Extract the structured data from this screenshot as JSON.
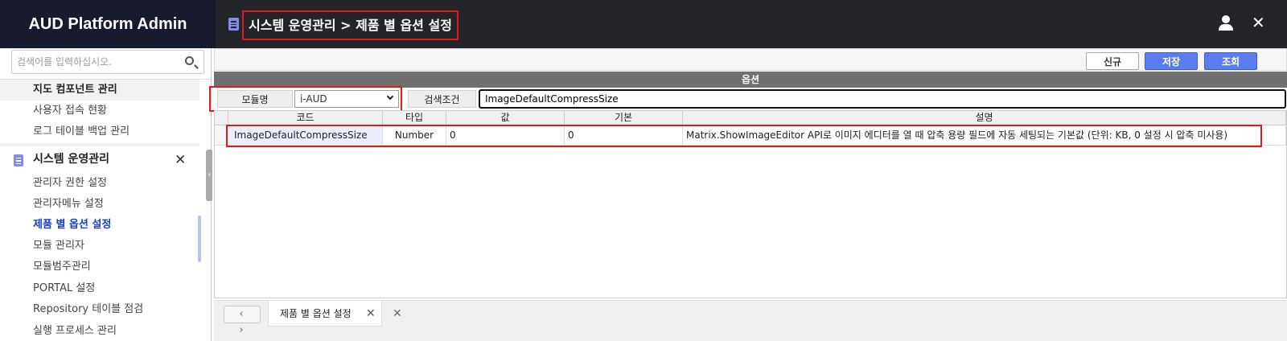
{
  "app": {
    "title": "AUD Platform Admin"
  },
  "header": {
    "page_title": "시스템 운영관리 > 제품 별 옵션 설정",
    "close_label": "✕"
  },
  "sidebar": {
    "search_placeholder": "검색어를 입력하십시오.",
    "items_before": [
      {
        "label": "지도 컴포넌트 관리"
      },
      {
        "label": "사용자 접속 현황"
      },
      {
        "label": "로그 테이블 백업 관리"
      }
    ],
    "group": {
      "label": "시스템 운영관리",
      "close_label": "✕"
    },
    "items": [
      {
        "label": "관리자 권한 설정"
      },
      {
        "label": "관리자메뉴 설정"
      },
      {
        "label": "제품 별 옵션 설정",
        "active": true
      },
      {
        "label": "모듈 관리자"
      },
      {
        "label": "모듈범주관리"
      },
      {
        "label": "PORTAL 설정"
      },
      {
        "label": "Repository 테이블 점검"
      },
      {
        "label": "실행 프로세스 관리"
      }
    ]
  },
  "toolbar": {
    "new_label": "신규",
    "save_label": "저장",
    "query_label": "조회"
  },
  "panel": {
    "title": "옵션"
  },
  "filters": {
    "module_label": "모듈명",
    "module_value": "i-AUD",
    "condition_label": "검색조건",
    "condition_value": "ImageDefaultCompressSize"
  },
  "grid": {
    "columns": [
      "코드",
      "타입",
      "값",
      "기본",
      "설명"
    ],
    "rows": [
      {
        "code": "ImageDefaultCompressSize",
        "type": "Number",
        "value": "0",
        "default": "0",
        "description": "Matrix.ShowImageEditor API로 이미지 에디터를 열 때 압축 용량 필드에 자동 세팅되는 기본값 (단위: KB, 0 설정 시 압축 미사용)"
      }
    ]
  },
  "bottom": {
    "nav_label": "‹ ›",
    "tab_label": "제품 별 옵션 설정",
    "tab_close": "✕",
    "close_all": "✕"
  },
  "colors": {
    "brand_bg": "#181b2e",
    "accent": "#5b7cf0",
    "highlight": "#e01b1b",
    "active_text": "#1a3ec8"
  },
  "icons": [
    "page-icon",
    "user-icon",
    "search-icon",
    "close-icon",
    "chevron-down-icon"
  ]
}
